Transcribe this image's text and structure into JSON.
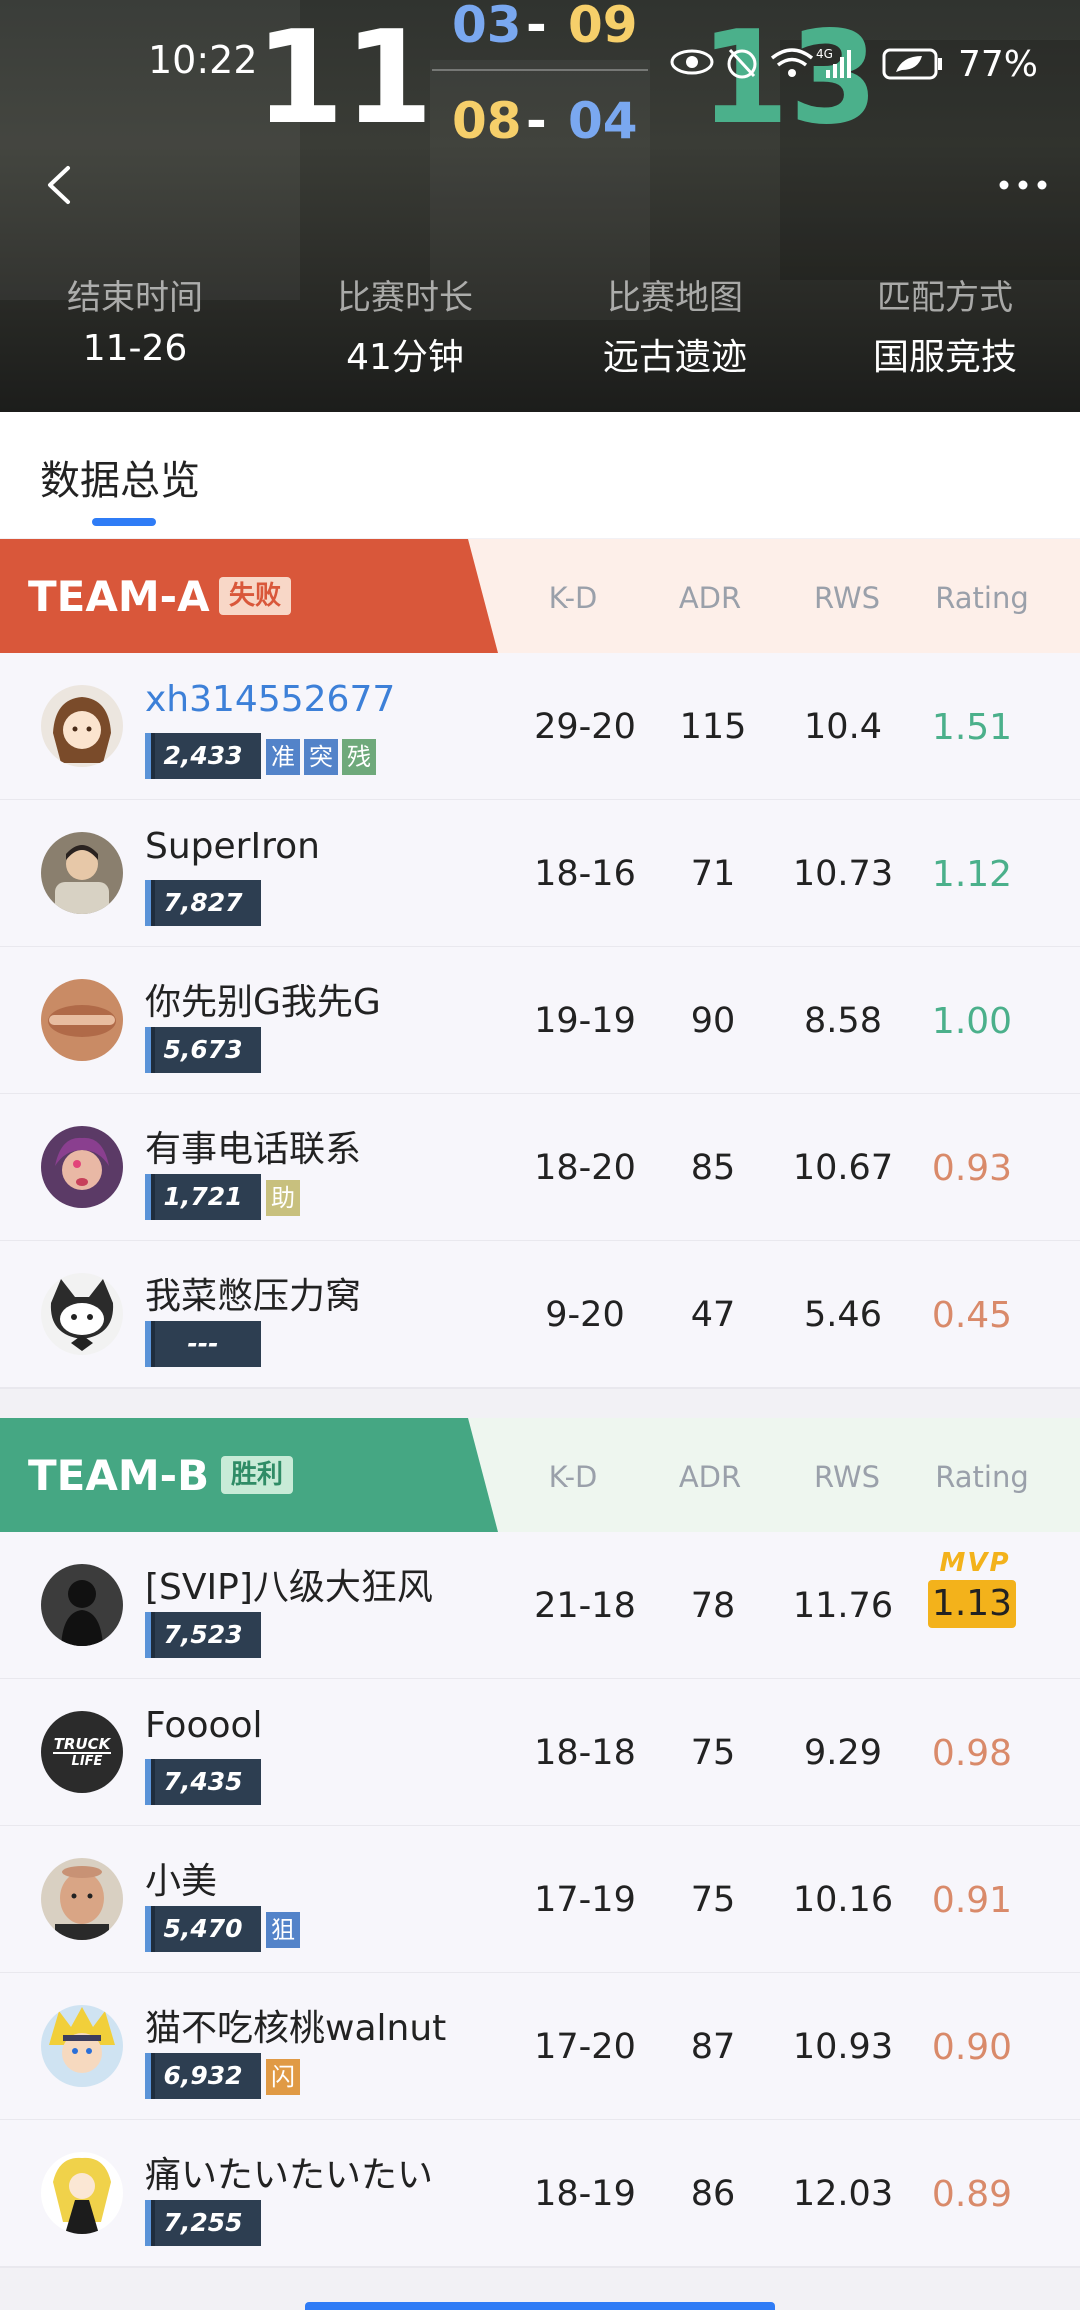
{
  "status_bar": {
    "time": "10:22",
    "battery": "77%",
    "icons": [
      "eye-icon",
      "alarm-icon",
      "wifi-icon",
      "signal-4g-icon",
      "battery-icon"
    ]
  },
  "match": {
    "score_a": "11",
    "score_b": "13",
    "half1_a": "03",
    "half1_b": "09",
    "half2_a": "08",
    "half2_b": "04",
    "dash": "-"
  },
  "meta": [
    {
      "label": "结束时间",
      "value": "11-26"
    },
    {
      "label": "比赛时长",
      "value": "41分钟"
    },
    {
      "label": "比赛地图",
      "value": "远古遗迹"
    },
    {
      "label": "匹配方式",
      "value": "国服竞技"
    }
  ],
  "tab": {
    "label": "数据总览"
  },
  "columns": [
    "K-D",
    "ADR",
    "RWS",
    "Rating"
  ],
  "team_a": {
    "name": "TEAM-A",
    "result": "失败",
    "color": "#d9573a",
    "players": [
      {
        "name": "xh314552677",
        "elo": "2,433",
        "tags": [
          "准",
          "突",
          "残"
        ],
        "kd": "29-20",
        "adr": "115",
        "rws": "10.4",
        "rating": "1.51"
      },
      {
        "name": "SuperIron",
        "elo": "7,827",
        "tags": [],
        "kd": "18-16",
        "adr": "71",
        "rws": "10.73",
        "rating": "1.12"
      },
      {
        "name": "你先别G我先G",
        "elo": "5,673",
        "tags": [],
        "kd": "19-19",
        "adr": "90",
        "rws": "8.58",
        "rating": "1.00"
      },
      {
        "name": "有事电话联系",
        "elo": "1,721",
        "tags": [
          "助"
        ],
        "kd": "18-20",
        "adr": "85",
        "rws": "10.67",
        "rating": "0.93"
      },
      {
        "name": "我菜憋压力窝",
        "elo": "---",
        "tags": [],
        "kd": "9-20",
        "adr": "47",
        "rws": "5.46",
        "rating": "0.45"
      }
    ]
  },
  "team_b": {
    "name": "TEAM-B",
    "result": "胜利",
    "color": "#45a783",
    "players": [
      {
        "name": "[SVIP]八级大狂风",
        "elo": "7,523",
        "tags": [],
        "kd": "21-18",
        "adr": "78",
        "rws": "11.76",
        "rating": "1.13",
        "mvp": "MVP"
      },
      {
        "name": "Fooool",
        "elo": "7,435",
        "tags": [],
        "kd": "18-18",
        "adr": "75",
        "rws": "9.29",
        "rating": "0.98"
      },
      {
        "name": "小美",
        "elo": "5,470",
        "tags": [
          "狙"
        ],
        "kd": "17-19",
        "adr": "75",
        "rws": "10.16",
        "rating": "0.91"
      },
      {
        "name": "猫不吃核桃walnut",
        "elo": "6,932",
        "tags": [
          "闪"
        ],
        "kd": "17-20",
        "adr": "87",
        "rws": "10.93",
        "rating": "0.90"
      },
      {
        "name": "痛いたいたいたい",
        "elo": "7,255",
        "tags": [],
        "kd": "18-19",
        "adr": "86",
        "rws": "12.03",
        "rating": "0.89"
      }
    ]
  },
  "colors": {
    "rating_good": "#4bb08b",
    "rating_bad": "#d98a6a",
    "mvp_gold": "#f3b21b",
    "accent_blue": "#2f7cf6",
    "half_blue": "#7aa8f0",
    "half_yellow": "#f6cf6a"
  }
}
